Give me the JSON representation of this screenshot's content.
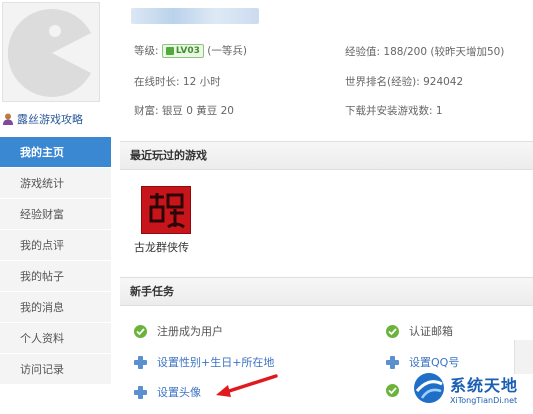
{
  "profile": {
    "username": "露丝游戏攻略"
  },
  "stats": {
    "level_label": "等级:",
    "level_badge": "LV03",
    "level_title": "(一等兵)",
    "exp_label": "经验值:",
    "exp_value": "188/200 (较昨天增加50)",
    "online_label": "在线时长:",
    "online_value": "12 小时",
    "rank_label": "世界排名(经验):",
    "rank_value": "924042",
    "wealth_label": "财富:",
    "wealth_value": "银豆 0  黄豆 20",
    "downloads_label": "下载并安装游戏数:",
    "downloads_value": "1"
  },
  "nav": {
    "items": [
      {
        "label": "我的主页",
        "active": true
      },
      {
        "label": "游戏统计"
      },
      {
        "label": "经验财富"
      },
      {
        "label": "我的点评"
      },
      {
        "label": "我的帖子"
      },
      {
        "label": "我的消息"
      },
      {
        "label": "个人资料"
      },
      {
        "label": "访问记录"
      }
    ]
  },
  "recent_games": {
    "title": "最近玩过的游戏",
    "games": [
      {
        "name": "古龙群侠传",
        "icon_text": "古龙"
      }
    ]
  },
  "tasks": {
    "title": "新手任务",
    "items": [
      {
        "label": "注册成为用户",
        "state": "done"
      },
      {
        "label": "认证邮箱",
        "state": "done"
      },
      {
        "label": "设置性别+生日+所在地",
        "state": "todo"
      },
      {
        "label": "设置QQ号",
        "state": "todo"
      },
      {
        "label": "设置头像",
        "state": "todo"
      }
    ]
  },
  "watermark": {
    "title": "系统天地",
    "url": "XiTongTianDi.net"
  },
  "colors": {
    "nav_active": "#3a87d2",
    "link": "#3b73c4",
    "check_green": "#6cb33b",
    "arrow_red": "#e0191e"
  }
}
